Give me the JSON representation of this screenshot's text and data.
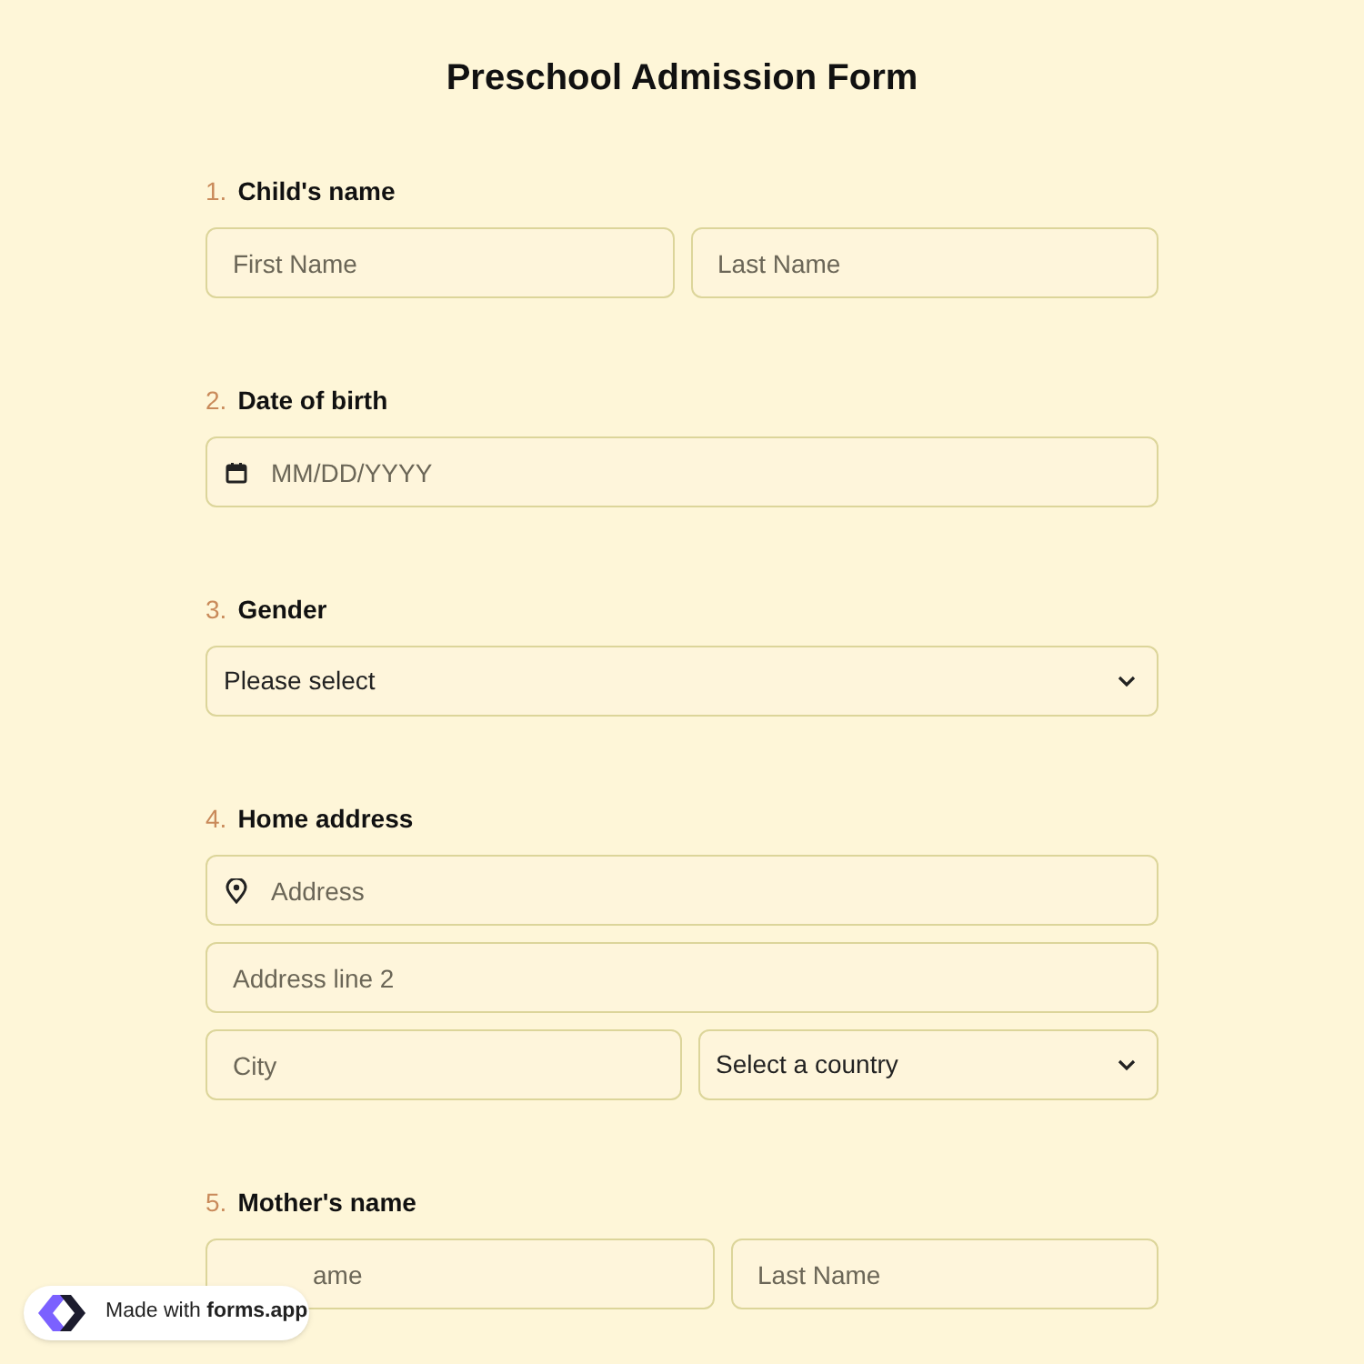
{
  "title": "Preschool Admission Form",
  "questions": [
    {
      "number": "1.",
      "label": "Child's name",
      "rows": [
        [
          {
            "kind": "text",
            "placeholder": "First Name"
          },
          {
            "kind": "text",
            "placeholder": "Last Name"
          }
        ]
      ]
    },
    {
      "number": "2.",
      "label": "Date of birth",
      "rows": [
        [
          {
            "kind": "date",
            "placeholder": "MM/DD/YYYY"
          }
        ]
      ]
    },
    {
      "number": "3.",
      "label": "Gender",
      "rows": [
        [
          {
            "kind": "select",
            "value": "Please select"
          }
        ]
      ]
    },
    {
      "number": "4.",
      "label": "Home address",
      "rows": [
        [
          {
            "kind": "address",
            "placeholder": "Address"
          }
        ],
        [
          {
            "kind": "text",
            "placeholder": "Address line 2"
          }
        ],
        [
          {
            "kind": "text",
            "placeholder": "City"
          },
          {
            "kind": "select",
            "value": "Select a country"
          }
        ]
      ]
    },
    {
      "number": "5.",
      "label": "Mother's name",
      "rows": [
        [
          {
            "kind": "covered",
            "placeholder": "ame"
          },
          {
            "kind": "text",
            "placeholder": "Last Name"
          }
        ]
      ]
    }
  ],
  "badge": {
    "text": "Made with **forms.app**"
  }
}
